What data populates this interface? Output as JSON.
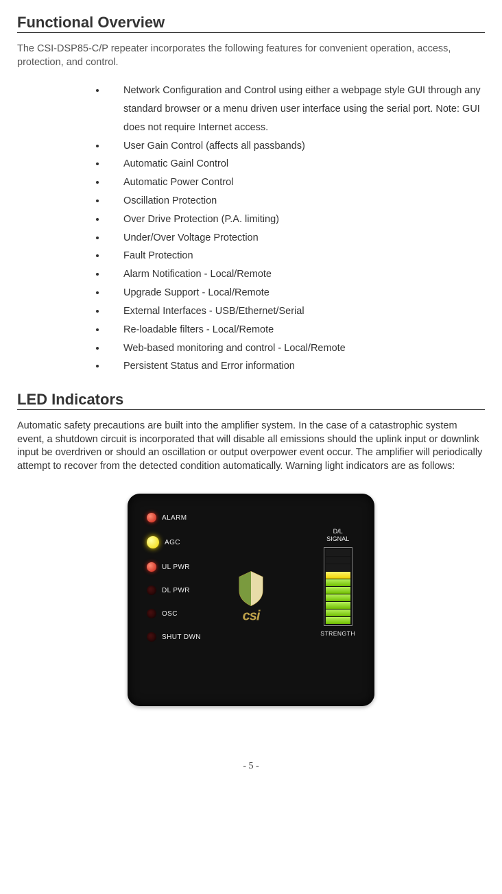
{
  "section1": {
    "heading": "Functional Overview",
    "intro": "The CSI-DSP85-C/P repeater incorporates the following features for convenient operation, access, protection, and control.",
    "features": [
      "Network Configuration and Control using  either a webpage style GUI through any standard  browser or a menu driven user interface using the serial port. Note: GUI does not require Internet access.",
      "User Gain Control (affects all passbands)",
      "Automatic Gainl Control",
      "Automatic Power Control",
      "Oscillation Protection",
      "Over Drive Protection (P.A. limiting)",
      "Under/Over Voltage Protection",
      "Fault Protection",
      "Alarm Notification - Local/Remote",
      "Upgrade Support - Local/Remote",
      "External Interfaces - USB/Ethernet/Serial",
      "Re-loadable filters - Local/Remote",
      "Web-based monitoring and control - Local/Remote",
      "Persistent Status and Error information"
    ]
  },
  "section2": {
    "heading": "LED Indicators",
    "body": "Automatic safety precautions are built into the amplifier system. In the case of a catastrophic system event, a shutdown circuit is incorporated that will disable all emissions should the uplink input or downlink input be overdriven or should an oscillation or output overpower event occur. The amplifier will periodically attempt to recover from the detected condition automatically. Warning light indicators are as follows:"
  },
  "panel": {
    "leds": {
      "alarm": "ALARM",
      "agc": "AGC",
      "ul_pwr": "UL PWR",
      "dl_pwr": "DL PWR",
      "osc": "OSC",
      "shut_dwn": "SHUT DWN"
    },
    "logo_text": "csi",
    "dl_signal": "D/L\nSIGNAL",
    "strength": "STRENGTH"
  },
  "page_number": "- 5 -"
}
